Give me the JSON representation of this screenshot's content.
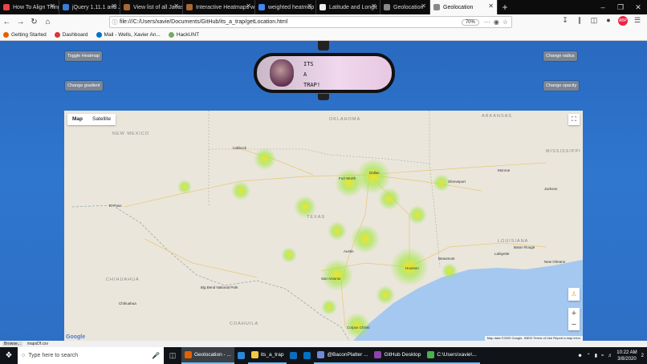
{
  "browser": {
    "tabs": [
      {
        "title": "How To Align Thing",
        "color": "#e44"
      },
      {
        "title": "jQuery 1.11.1 and J",
        "color": "#3a7bd5"
      },
      {
        "title": "View list of all Javas",
        "color": "#a63"
      },
      {
        "title": "Interactive Heatmaps w",
        "color": "#a63"
      },
      {
        "title": "weighted heatmap",
        "color": "#4285f4"
      },
      {
        "title": "Latitude and Longit",
        "color": "#eee"
      },
      {
        "title": "Geolocation",
        "color": "#888"
      },
      {
        "title": "Geolocation",
        "color": "#888"
      }
    ],
    "new_tab": "+",
    "url": "file:///C:/Users/xavie/Documents/GitHub/its_a_trap/getLocation.html",
    "zoom": "70%",
    "bookmarks": [
      {
        "label": "Getting Started",
        "color": "#e66000"
      },
      {
        "label": "Dashboard",
        "color": "#d33"
      },
      {
        "label": "Mail - Wells, Xavier An...",
        "color": "#0072c6"
      },
      {
        "label": "HackUNT",
        "color": "#7a6"
      }
    ]
  },
  "page": {
    "buttons": {
      "toggle_heatmap": "Toggle Heatmap",
      "change_gradient": "Change gradient",
      "change_radius": "Change radius",
      "change_opacity": "Change opacity"
    },
    "mirror_text": "ITS\nA\nTRAP!",
    "map": {
      "type_map": "Map",
      "type_satellite": "Satellite",
      "logo": "Google",
      "attribution": "Map data ©2020 Google, INEGI   Terms of Use   Report a map error",
      "labels": {
        "new_mexico": "NEW MEXICO",
        "texas": "TEXAS",
        "chihuahua": "CHIHUAHUA",
        "coahuila": "COAHUILA",
        "louisiana": "LOUISIANA",
        "arkansas": "ARKANSAS",
        "oklahoma": "OKLAHOMA",
        "mississippi": "MISSISSIPPI",
        "lubbock": "Lubbock",
        "el_paso": "El Paso",
        "dallas": "Dallas",
        "fort_worth": "Fort Worth",
        "austin": "Austin",
        "houston": "Houston",
        "san_antonio": "San Antonio",
        "shreveport": "Shreveport",
        "corpus_christi": "Corpus Christi",
        "baton_rouge": "Baton Rouge",
        "new_orleans": "New Orleans",
        "chihuahua_city": "Chihuahua",
        "jackson": "Jackson",
        "big_bend": "Big Bend National Park",
        "lafayette": "Lafayette",
        "beaumont": "Beaumont",
        "monroe": "Monroe"
      }
    }
  },
  "statusbar": {
    "left": "Browse...",
    "file": "mapsDf.csv"
  },
  "taskbar": {
    "search_placeholder": "Type here to search",
    "apps": [
      {
        "label": "Geolocation - ...",
        "color": "#e66000",
        "active": true
      },
      {
        "label": "",
        "color": "#2b88d8",
        "active": false
      },
      {
        "label": "its_a_trap",
        "color": "#f2c744",
        "active": false
      },
      {
        "label": "",
        "color": "#0f6cbd",
        "active": false
      },
      {
        "label": "",
        "color": "#0072c6",
        "active": false
      },
      {
        "label": "@BaconPlatter ...",
        "color": "#7289da",
        "active": false
      },
      {
        "label": "GitHub Desktop",
        "color": "#8e44ad",
        "active": false
      },
      {
        "label": "C:\\Users\\xavie\\...",
        "color": "#4caf50",
        "active": false
      }
    ],
    "time": "10:22 AM",
    "date": "3/8/2020",
    "notifications": "2"
  }
}
